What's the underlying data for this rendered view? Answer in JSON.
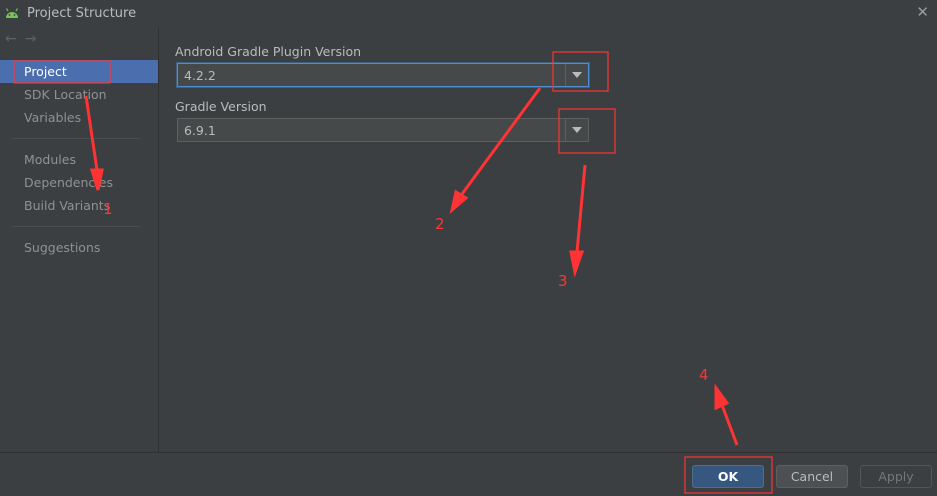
{
  "window": {
    "title": "Project Structure",
    "close_glyph": "✕"
  },
  "nav": {
    "back": "←",
    "forward": "→"
  },
  "sidebar": {
    "items": [
      {
        "label": "Project",
        "selected": true
      },
      {
        "label": "SDK Location"
      },
      {
        "label": "Variables"
      },
      {
        "label": "Modules"
      },
      {
        "label": "Dependencies"
      },
      {
        "label": "Build Variants"
      },
      {
        "label": "Suggestions"
      }
    ]
  },
  "main": {
    "agp_label": "Android Gradle Plugin Version",
    "agp_value": "4.2.2",
    "gradle_label": "Gradle Version",
    "gradle_value": "6.9.1"
  },
  "footer": {
    "ok": "OK",
    "cancel": "Cancel",
    "apply": "Apply"
  },
  "annotations": {
    "n1": "1",
    "n2": "2",
    "n3": "3",
    "n4": "4",
    "color": "#ff3333"
  },
  "colors": {
    "selection": "#4b6eaf",
    "ok_button": "#365880",
    "background": "#3c3f41"
  }
}
